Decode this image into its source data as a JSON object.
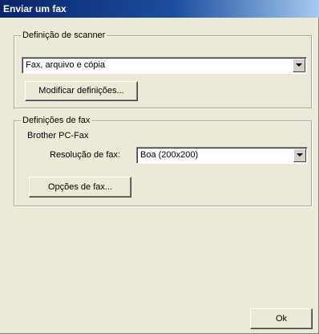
{
  "window": {
    "title": "Enviar um fax"
  },
  "scanner_group": {
    "legend": "Definição de scanner",
    "combo_value": "Fax, arquivo e cópia",
    "modify_button": "Modificar definições..."
  },
  "fax_group": {
    "legend": "Definições de fax",
    "device_name": "Brother PC-Fax",
    "resolution_label": "Resolução de fax:",
    "resolution_value": "Boa (200x200)",
    "options_button": "Opções de fax..."
  },
  "footer": {
    "ok_label": "Ok"
  },
  "colors": {
    "titlebar": "#0a246a",
    "dialog_bg": "#ece9d8"
  },
  "icons": {
    "dropdown": "chevron-down-icon"
  }
}
